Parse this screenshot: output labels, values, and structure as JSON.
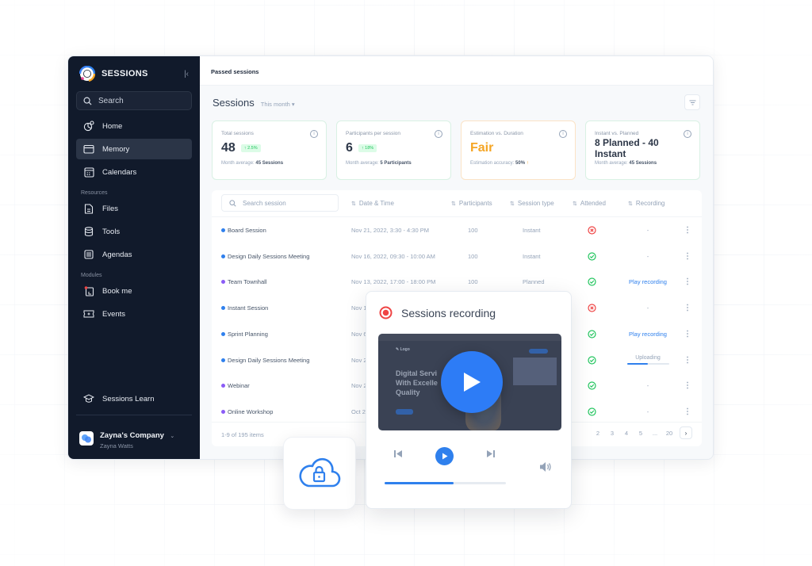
{
  "colors": {
    "sidebar_bg": "#111a2b",
    "accent_blue": "#2f80ed",
    "success_green": "#22c55e",
    "danger_red": "#ef4444",
    "warning_orange": "#f5a524",
    "dot_blue": "#2f80ed",
    "dot_purple": "#8b5cf6"
  },
  "sidebar": {
    "brand": "SESSIONS",
    "collapse_icon": "collapse-left-icon",
    "search_placeholder": "Search",
    "primary_items": [
      {
        "label": "Home",
        "icon": "home-chart-icon"
      },
      {
        "label": "Memory",
        "icon": "folder-icon",
        "active": true
      },
      {
        "label": "Calendars",
        "icon": "calendar-icon"
      }
    ],
    "resources_label": "Resources",
    "resources_items": [
      {
        "label": "Files",
        "icon": "file-icon"
      },
      {
        "label": "Tools",
        "icon": "database-icon"
      },
      {
        "label": "Agendas",
        "icon": "list-icon"
      }
    ],
    "modules_label": "Modules",
    "modules_items": [
      {
        "label": "Book me",
        "icon": "book-icon"
      },
      {
        "label": "Events",
        "icon": "ticket-icon"
      }
    ],
    "learn_label": "Sessions Learn",
    "company_name": "Zayna's Company",
    "company_user": "Zayna Watts"
  },
  "topbar": {
    "breadcrumb": "Passed sessions"
  },
  "header": {
    "title": "Sessions",
    "period": "This month ▾"
  },
  "cards": [
    {
      "label": "Total sessions",
      "value": "48",
      "badge": "↑ 2.5%",
      "foot_prefix": "Month average:",
      "foot_value": "45 Sessions"
    },
    {
      "label": "Participants per session",
      "value": "6",
      "badge": "↑ 18%",
      "foot_prefix": "Month average:",
      "foot_value": "5 Participants"
    },
    {
      "label": "Estimation vs. Duration",
      "value": "Fair",
      "foot_prefix": "Estimation accuracy:",
      "foot_value": "50%",
      "foot_trend": "↑"
    },
    {
      "label": "Instant vs. Planned",
      "value": "8 Planned - 40 Instant",
      "foot_prefix": "Month average:",
      "foot_value": "45 Sessions"
    }
  ],
  "table": {
    "search_placeholder": "Search session",
    "columns": [
      "Date & Time",
      "Participants",
      "Session type",
      "Attended",
      "Recording"
    ],
    "rows": [
      {
        "name": "Board Session",
        "dot": "blue",
        "date": "Nov 21, 2022, 3:30 - 4:30 PM",
        "participants": "100",
        "type": "Instant",
        "attended": false,
        "recording": "-"
      },
      {
        "name": "Design Daily Sessions Meeting",
        "dot": "blue",
        "date": "Nov 16, 2022, 09:30 - 10:00 AM",
        "participants": "100",
        "type": "Instant",
        "attended": true,
        "recording": "-"
      },
      {
        "name": "Team Townhall",
        "dot": "purple",
        "date": "Nov 13, 2022, 17:00 - 18:00 PM",
        "participants": "100",
        "type": "Planned",
        "attended": true,
        "recording": "Play recording"
      },
      {
        "name": "Instant Session",
        "dot": "blue",
        "date": "Nov 1",
        "participants": "",
        "type": "",
        "attended": false,
        "recording": "-"
      },
      {
        "name": "Sprint Planning",
        "dot": "blue",
        "date": "Nov 6",
        "participants": "",
        "type": "",
        "attended": true,
        "recording": "Play recording"
      },
      {
        "name": "Design Daily Sessions Meeting",
        "dot": "blue",
        "date": "Nov 2",
        "participants": "",
        "type": "",
        "attended": true,
        "recording": "Uploading",
        "upload_progress": 0.5
      },
      {
        "name": "Webinar",
        "dot": "purple",
        "date": "Nov 2",
        "participants": "",
        "type": "",
        "attended": true,
        "recording": "-"
      },
      {
        "name": "Online Workshop",
        "dot": "purple",
        "date": "Oct 2",
        "participants": "",
        "type": "",
        "attended": true,
        "recording": "-"
      }
    ],
    "footer_count": "1-9 of 195 items",
    "pages": [
      "2",
      "3",
      "4",
      "5",
      "...",
      "20"
    ],
    "next_label": "›"
  },
  "recording_panel": {
    "title": "Sessions recording",
    "video_heading": [
      "Digital Servi",
      "With Excelle",
      "Quality"
    ],
    "video_logo": "✎ Logo",
    "progress": 0.57
  }
}
